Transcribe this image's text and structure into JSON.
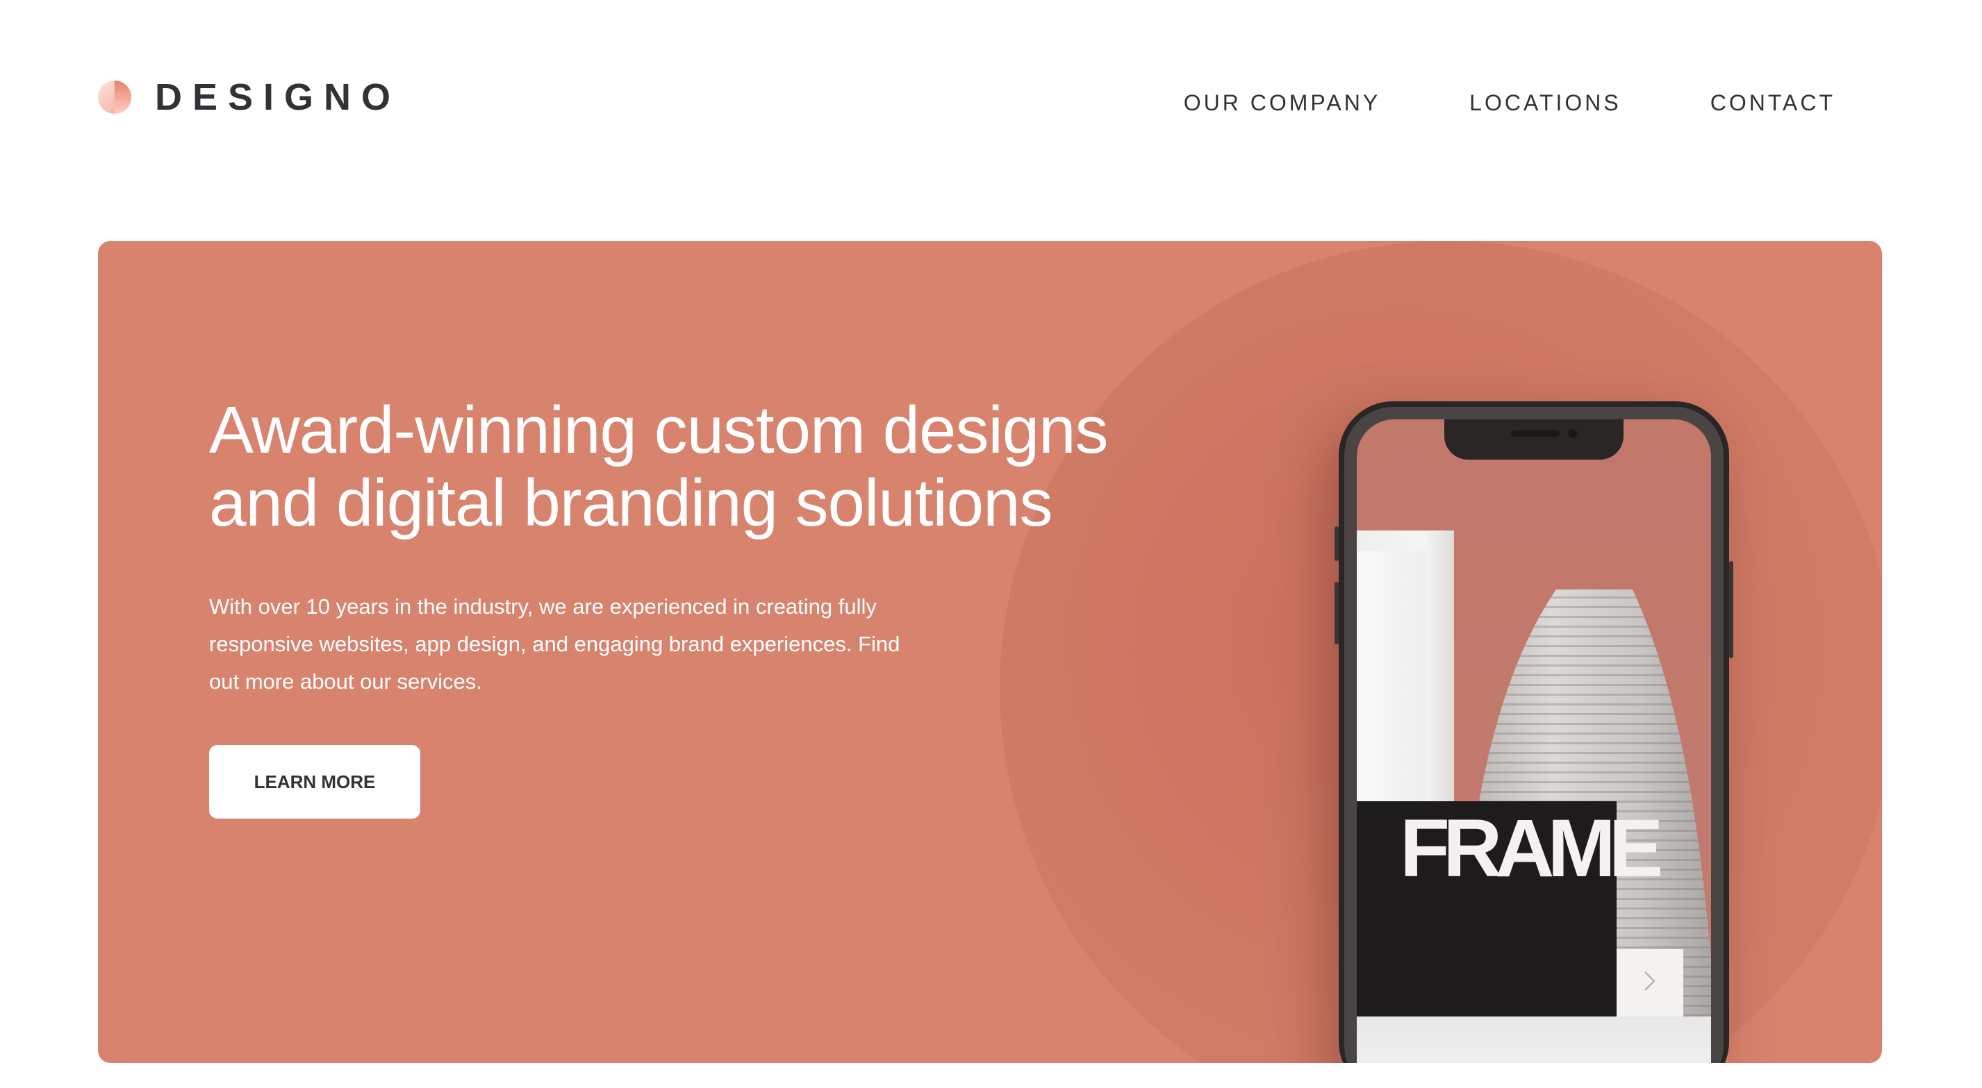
{
  "brand": {
    "name": "DESIGNO",
    "logo_icon": "half-circle-logo-icon",
    "logo_colors": [
      "#e7816b",
      "#ffc0b5"
    ]
  },
  "nav": {
    "items": [
      {
        "label": "OUR COMPANY"
      },
      {
        "label": "LOCATIONS"
      },
      {
        "label": "CONTACT"
      }
    ]
  },
  "hero": {
    "title_lines": [
      "Award-winning custom designs",
      "and digital branding solutions"
    ],
    "description_lines": [
      "With over 10 years in the industry, we are experienced in creating fully",
      "responsive websites, app design, and engaging brand experiences. Find",
      "out more about our services."
    ],
    "cta_label": "LEARN MORE",
    "background_color": "#d8836e"
  },
  "phone_mockup": {
    "screen_title": "FRAME",
    "next_icon": "chevron-right-icon"
  },
  "colors": {
    "peach": "#d8836e",
    "dark_text": "#333136",
    "white": "#ffffff"
  }
}
